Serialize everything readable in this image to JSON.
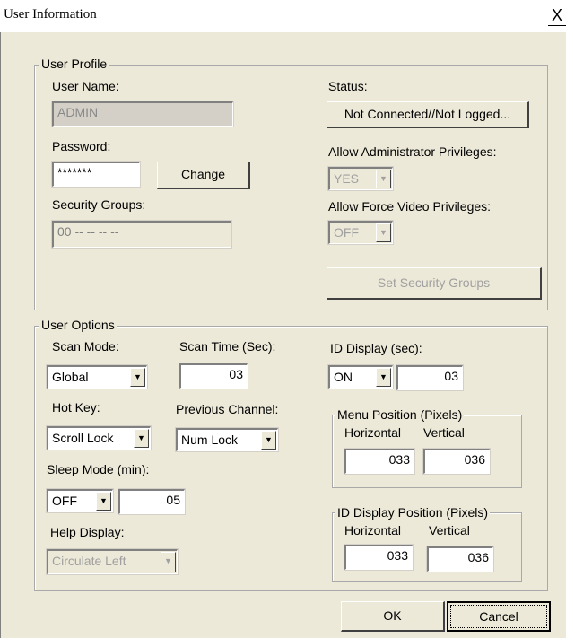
{
  "window": {
    "title": "User Information",
    "close_glyph": "X"
  },
  "profile": {
    "group_label": "User Profile",
    "user_name_label": "User Name:",
    "user_name_value": "ADMIN",
    "password_label": "Password:",
    "password_value": "*******",
    "change_button": "Change",
    "security_groups_label": "Security Groups:",
    "security_groups_value": "00 -- -- -- --",
    "status_label": "Status:",
    "status_button": "Not Connected//Not Logged...",
    "admin_priv_label": "Allow Administrator Privileges:",
    "admin_priv_value": "YES",
    "force_video_label": "Allow Force Video Privileges:",
    "force_video_value": "OFF",
    "set_security_button": "Set Security Groups"
  },
  "options": {
    "group_label": "User Options",
    "scan_mode_label": "Scan Mode:",
    "scan_mode_value": "Global",
    "scan_time_label": "Scan Time (Sec):",
    "scan_time_value": "03",
    "id_display_label": "ID Display (sec):",
    "id_display_value": "ON",
    "id_display_seconds": "03",
    "hot_key_label": "Hot Key:",
    "hot_key_value": "Scroll Lock",
    "prev_channel_label": "Previous Channel:",
    "prev_channel_value": "Num Lock",
    "menu_position": {
      "group_label": "Menu Position (Pixels)",
      "horizontal_label": "Horizontal",
      "vertical_label": "Vertical",
      "horizontal_value": "033",
      "vertical_value": "036"
    },
    "sleep_mode_label": "Sleep Mode (min):",
    "sleep_mode_value": "OFF",
    "sleep_mode_minutes": "05",
    "help_display_label": "Help Display:",
    "help_display_value": "Circulate Left",
    "id_display_position": {
      "group_label": "ID Display Position (Pixels)",
      "horizontal_label": "Horizontal",
      "vertical_label": "Vertical",
      "horizontal_value": "033",
      "vertical_value": "036"
    }
  },
  "footer": {
    "ok_button": "OK",
    "cancel_button": "Cancel"
  },
  "icons": {
    "dropdown_arrow": "▼"
  }
}
